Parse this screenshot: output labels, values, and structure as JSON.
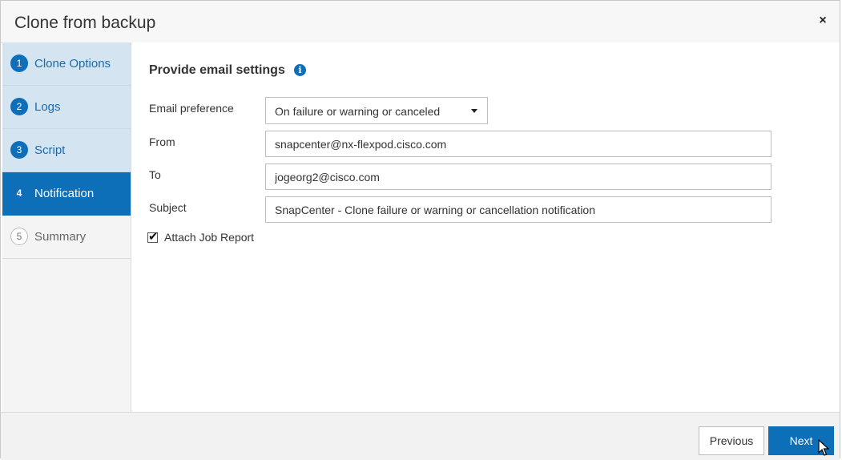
{
  "dialog": {
    "title": "Clone from backup",
    "close_icon": "×"
  },
  "wizard": {
    "steps": [
      {
        "number": "1",
        "label": "Clone Options",
        "state": "completed"
      },
      {
        "number": "2",
        "label": "Logs",
        "state": "completed"
      },
      {
        "number": "3",
        "label": "Script",
        "state": "completed"
      },
      {
        "number": "4",
        "label": "Notification",
        "state": "active"
      },
      {
        "number": "5",
        "label": "Summary",
        "state": "pending"
      }
    ]
  },
  "form": {
    "heading": "Provide email settings",
    "info_icon": "i",
    "email_preference_label": "Email preference",
    "email_preference_value": "On failure or warning or canceled",
    "from_label": "From",
    "from_value": "snapcenter@nx-flexpod.cisco.com",
    "to_label": "To",
    "to_value": "jogeorg2@cisco.com",
    "subject_label": "Subject",
    "subject_value": "SnapCenter - Clone failure or warning or cancellation notification",
    "attach_job_report_label": "Attach Job Report",
    "attach_job_report_checked": true,
    "checkmark": "✔"
  },
  "footer": {
    "previous_label": "Previous",
    "next_label": "Next"
  },
  "colors": {
    "accent": "#0d6fb8",
    "completed_step_bg": "#d4e5f1"
  }
}
